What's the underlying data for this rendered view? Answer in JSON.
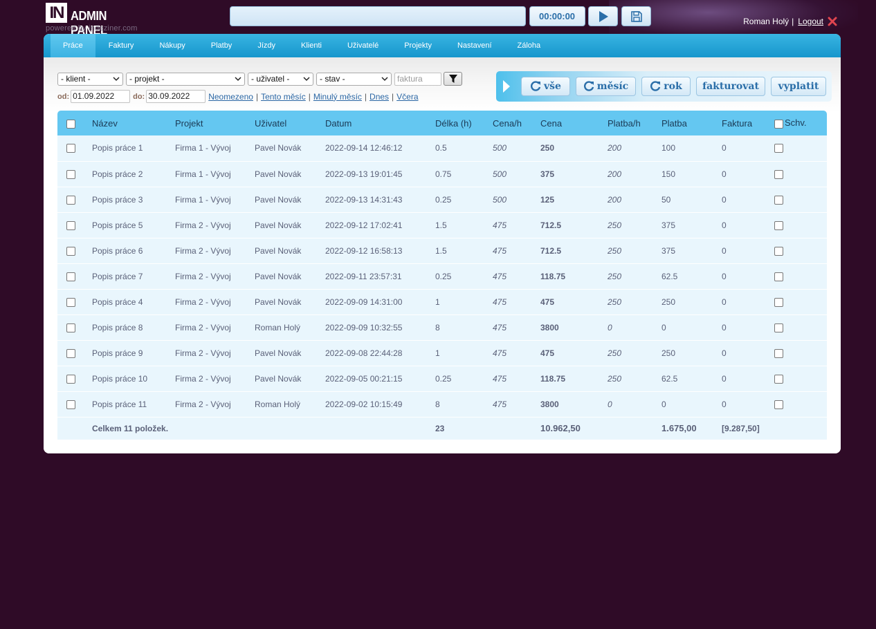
{
  "header": {
    "logo_mark": "IN",
    "logo_title": "ADMIN PANEL",
    "logo_sub": "powered by indeziner.com",
    "timer_value": "00:00:00",
    "user_name": "Roman Holý",
    "separator": "|",
    "logout_label": "Logout"
  },
  "nav": {
    "items": [
      {
        "label": "Práce"
      },
      {
        "label": "Faktury"
      },
      {
        "label": "Nákupy"
      },
      {
        "label": "Platby"
      },
      {
        "label": "Jízdy"
      },
      {
        "label": "Klienti"
      },
      {
        "label": "Uživatelé"
      },
      {
        "label": "Projekty"
      },
      {
        "label": "Nastavení"
      },
      {
        "label": "Záloha"
      }
    ]
  },
  "filters": {
    "client": "- klient -",
    "project": "- projekt -",
    "user": "- uživatel -",
    "state": "- stav -",
    "invoice_placeholder": "faktura",
    "from_label": "od:",
    "from_value": "01.09.2022",
    "to_label": "do:",
    "to_value": "30.09.2022",
    "quick_links": [
      "Neomezeno",
      "Tento měsíc",
      "Minulý měsíc",
      "Dnes",
      "Včera"
    ]
  },
  "actions": {
    "all": "vše",
    "month": "měsíc",
    "year": "rok",
    "invoice": "fakturovat",
    "pay": "vyplatit"
  },
  "table": {
    "headers": [
      "Název",
      "Projekt",
      "Uživatel",
      "Datum",
      "Délka (h)",
      "Cena/h",
      "Cena",
      "Platba/h",
      "Platba",
      "Faktura",
      "Schv."
    ],
    "rows": [
      [
        "Popis práce 1",
        "Firma 1 - Vývoj",
        "Pavel Novák",
        "2022-09-14 12:46:12",
        "0.5",
        "500",
        "250",
        "200",
        "100",
        "0"
      ],
      [
        "Popis práce 2",
        "Firma 1 - Vývoj",
        "Pavel Novák",
        "2022-09-13 19:01:45",
        "0.75",
        "500",
        "375",
        "200",
        "150",
        "0"
      ],
      [
        "Popis práce 3",
        "Firma 1 - Vývoj",
        "Pavel Novák",
        "2022-09-13 14:31:43",
        "0.25",
        "500",
        "125",
        "200",
        "50",
        "0"
      ],
      [
        "Popis práce 5",
        "Firma 2 - Vývoj",
        "Pavel Novák",
        "2022-09-12 17:02:41",
        "1.5",
        "475",
        "712.5",
        "250",
        "375",
        "0"
      ],
      [
        "Popis práce 6",
        "Firma 2 - Vývoj",
        "Pavel Novák",
        "2022-09-12 16:58:13",
        "1.5",
        "475",
        "712.5",
        "250",
        "375",
        "0"
      ],
      [
        "Popis práce 7",
        "Firma 2 - Vývoj",
        "Pavel Novák",
        "2022-09-11 23:57:31",
        "0.25",
        "475",
        "118.75",
        "250",
        "62.5",
        "0"
      ],
      [
        "Popis práce 4",
        "Firma 2 - Vývoj",
        "Pavel Novák",
        "2022-09-09 14:31:00",
        "1",
        "475",
        "475",
        "250",
        "250",
        "0"
      ],
      [
        "Popis práce 8",
        "Firma 2 - Vývoj",
        "Roman Holý",
        "2022-09-09 10:32:55",
        "8",
        "475",
        "3800",
        "0",
        "0",
        "0"
      ],
      [
        "Popis práce 9",
        "Firma 2 - Vývoj",
        "Pavel Novák",
        "2022-09-08 22:44:28",
        "1",
        "475",
        "475",
        "250",
        "250",
        "0"
      ],
      [
        "Popis práce 10",
        "Firma 2 - Vývoj",
        "Pavel Novák",
        "2022-09-05 00:21:15",
        "0.25",
        "475",
        "118.75",
        "250",
        "62.5",
        "0"
      ],
      [
        "Popis práce 11",
        "Firma 2 - Vývoj",
        "Roman Holý",
        "2022-09-02 10:15:49",
        "8",
        "475",
        "3800",
        "0",
        "0",
        "0"
      ]
    ],
    "footer": {
      "label": "Celkem 11 položek.",
      "hours": "23",
      "price": "10.962,50",
      "payment": "1.675,00",
      "invoice": "[9.287,50]"
    }
  }
}
